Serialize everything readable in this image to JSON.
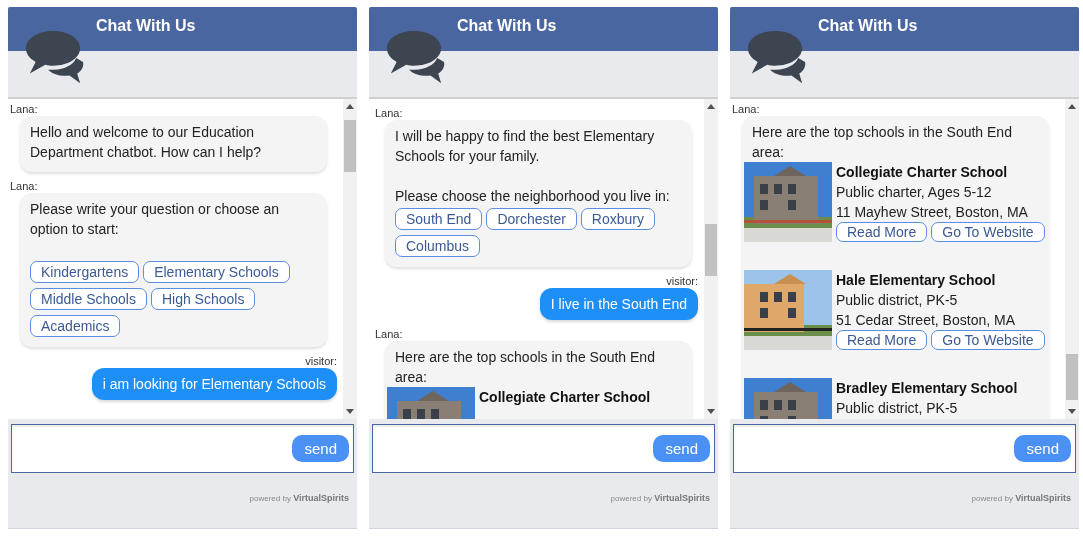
{
  "panels": [
    {
      "title": "Chat With Us",
      "messages": [
        {
          "kind": "bot",
          "sender": "Lana:",
          "paragraphs": [
            "Hello and welcome to our Education Department chatbot. How can I help?"
          ]
        },
        {
          "kind": "bot",
          "sender": "Lana:",
          "paragraphs": [
            "Please write your question or choose an option to start:"
          ],
          "gap": true,
          "options": [
            "Kindergartens",
            "Elementary Schools",
            "Middle Schools",
            "High Schools",
            "Academics"
          ]
        },
        {
          "kind": "visitor",
          "sender": "visitor:",
          "paragraphs": [
            "i am looking for Elementary Schools"
          ]
        }
      ],
      "send": "send",
      "powered_by": "powered by",
      "brand": "VirtualSpirits"
    },
    {
      "title": "Chat With Us",
      "messages": [
        {
          "kind": "bot",
          "sender": "Lana:",
          "paragraphs": [
            "I will be happy to find the best Elementary Schools for your family.",
            "Please choose the neighborhood you live in:"
          ],
          "options": [
            "South End",
            "Dorchester",
            "Roxbury",
            "Columbus"
          ]
        },
        {
          "kind": "visitor",
          "sender": "visitor:",
          "paragraphs": [
            "I live in the South End"
          ]
        },
        {
          "kind": "bot",
          "sender": "Lana:",
          "paragraphs": [
            "Here are the top schools in the South End area:"
          ],
          "schools": [
            {
              "name": "Collegiate Charter School",
              "image": {
                "kind": "picture"
              }
            }
          ]
        }
      ],
      "send": "send",
      "powered_by": "powered by",
      "brand": "VirtualSpirits"
    },
    {
      "title": "Chat With Us",
      "messages": [
        {
          "kind": "bot",
          "sender": "Lana:",
          "paragraphs": [
            "Here are the top schools in the South End area:"
          ],
          "schools": [
            {
              "name": "Collegiate Charter School",
              "image": {
                "kind": "picture"
              },
              "type": "Public charter, Ages 5-12",
              "address": "11 Mayhew Street, Boston, MA",
              "buttons": [
                "Read More",
                "Go To Website"
              ]
            },
            {
              "name": "Hale Elementary School",
              "image": {
                "kind": "picture"
              },
              "type": "Public district, PK-5",
              "address": "51 Cedar Street, Boston, MA",
              "buttons": [
                "Read More",
                "Go To Website"
              ]
            },
            {
              "name": "Bradley Elementary School",
              "image": {
                "kind": "picture"
              },
              "type": "Public district, PK-5"
            }
          ]
        }
      ],
      "send": "send",
      "powered_by": "powered by",
      "brand": "VirtualSpirits"
    }
  ]
}
